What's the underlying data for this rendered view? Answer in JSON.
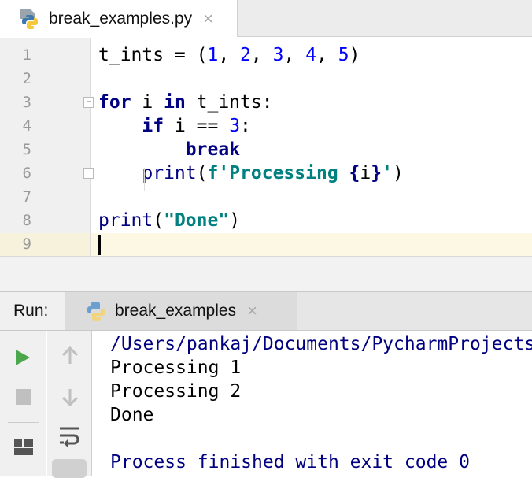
{
  "editor_tab": {
    "filename": "break_examples.py",
    "close": "×"
  },
  "editor": {
    "line_numbers": [
      "1",
      "2",
      "3",
      "4",
      "5",
      "6",
      "7",
      "8",
      "9"
    ],
    "lines": [
      [
        [
          "plain",
          "t_ints = ("
        ],
        [
          "num",
          "1"
        ],
        [
          "plain",
          ", "
        ],
        [
          "num",
          "2"
        ],
        [
          "plain",
          ", "
        ],
        [
          "num",
          "3"
        ],
        [
          "plain",
          ", "
        ],
        [
          "num",
          "4"
        ],
        [
          "plain",
          ", "
        ],
        [
          "num",
          "5"
        ],
        [
          "plain",
          ")"
        ]
      ],
      [],
      [
        [
          "kw",
          "for"
        ],
        [
          "plain",
          " i "
        ],
        [
          "kw",
          "in"
        ],
        [
          "plain",
          " t_ints:"
        ]
      ],
      [
        [
          "plain",
          "    "
        ],
        [
          "kw",
          "if"
        ],
        [
          "plain",
          " i == "
        ],
        [
          "num",
          "3"
        ],
        [
          "plain",
          ":"
        ]
      ],
      [
        [
          "plain",
          "        "
        ],
        [
          "kw",
          "break"
        ]
      ],
      [
        [
          "plain",
          "    "
        ],
        [
          "bi",
          "print"
        ],
        [
          "plain",
          "("
        ],
        [
          "str",
          "f'Processing "
        ],
        [
          "br",
          "{"
        ],
        [
          "plain",
          "i"
        ],
        [
          "br",
          "}"
        ],
        [
          "str",
          "'"
        ],
        [
          "plain",
          ")"
        ]
      ],
      [],
      [
        [
          "bi",
          "print"
        ],
        [
          "plain",
          "("
        ],
        [
          "str",
          "\"Done\""
        ],
        [
          "plain",
          ")"
        ]
      ],
      []
    ],
    "current_line": "9"
  },
  "run_panel": {
    "label": "Run:",
    "tab": "break_examples",
    "close": "×",
    "output": [
      {
        "text": "/Users/pankaj/Documents/PycharmProjects",
        "style": "navy"
      },
      {
        "text": "Processing 1",
        "style": "plain"
      },
      {
        "text": "Processing 2",
        "style": "plain"
      },
      {
        "text": "Done",
        "style": "plain"
      },
      {
        "text": "",
        "style": "plain"
      },
      {
        "text": "Process finished with exit code 0",
        "style": "navy"
      }
    ]
  }
}
